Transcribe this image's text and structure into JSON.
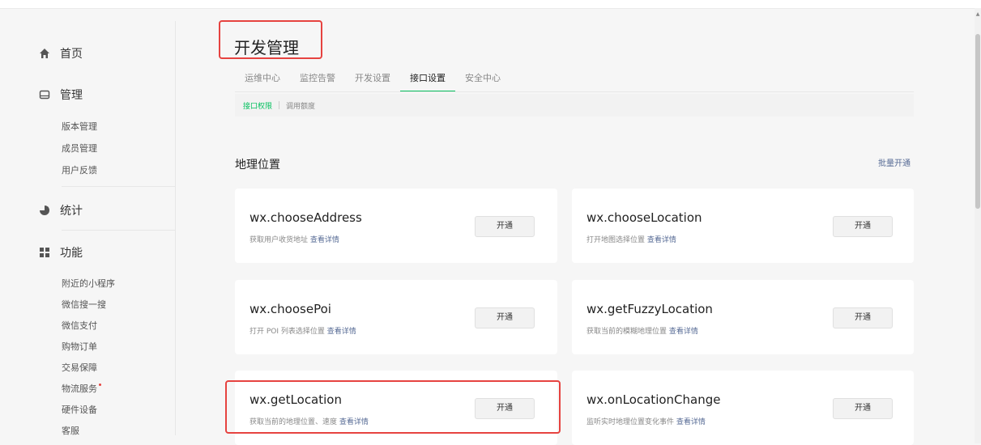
{
  "sidebar": {
    "groups": [
      {
        "label": "首页",
        "icon": "home-icon"
      },
      {
        "label": "管理",
        "icon": "manage-icon"
      },
      {
        "label": "统计",
        "icon": "stats-icon"
      },
      {
        "label": "功能",
        "icon": "function-icon"
      }
    ],
    "manage_items": [
      "版本管理",
      "成员管理",
      "用户反馈"
    ],
    "function_items": [
      "附近的小程序",
      "微信搜一搜",
      "微信支付",
      "购物订单",
      "交易保障",
      "物流服务",
      "硬件设备",
      "客服"
    ]
  },
  "page": {
    "title": "开发管理",
    "tabs": [
      "运维中心",
      "监控告警",
      "开发设置",
      "接口设置",
      "安全中心"
    ],
    "active_tab": "接口设置",
    "subtabs": [
      "接口权限",
      "调用额度"
    ],
    "active_subtab": "接口权限"
  },
  "section": {
    "title": "地理位置",
    "bulk_action": "批量开通"
  },
  "apis": [
    {
      "name": "wx.chooseAddress",
      "desc": "获取用户收货地址",
      "more": "查看详情",
      "button": "开通"
    },
    {
      "name": "wx.chooseLocation",
      "desc": "打开地图选择位置",
      "more": "查看详情",
      "button": "开通"
    },
    {
      "name": "wx.choosePoi",
      "desc": "打开 POI 列表选择位置",
      "more": "查看详情",
      "button": "开通"
    },
    {
      "name": "wx.getFuzzyLocation",
      "desc": "获取当前的模糊地理位置",
      "more": "查看详情",
      "button": "开通"
    },
    {
      "name": "wx.getLocation",
      "desc": "获取当前的地理位置、速度",
      "more": "查看详情",
      "button": "开通"
    },
    {
      "name": "wx.onLocationChange",
      "desc": "监听实时地理位置变化事件",
      "more": "查看详情",
      "button": "开通"
    }
  ],
  "colors": {
    "accent_green": "#07c160",
    "link_blue": "#576b95",
    "highlight_red": "#e64340"
  }
}
